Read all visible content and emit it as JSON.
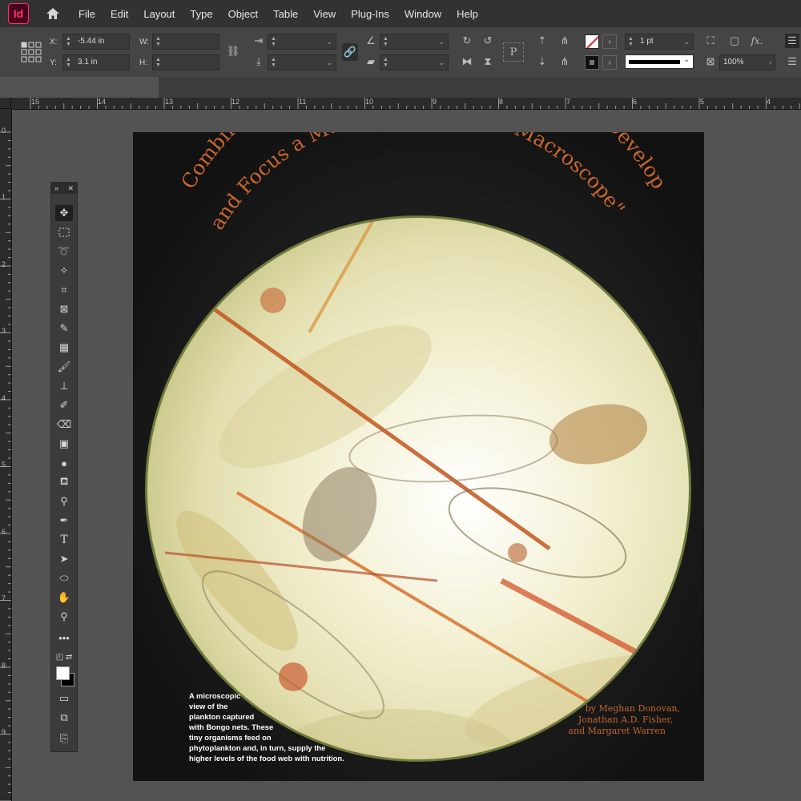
{
  "app": {
    "logo_text": "Id"
  },
  "menu": [
    "File",
    "Edit",
    "Layout",
    "Type",
    "Object",
    "Table",
    "View",
    "Plug-Ins",
    "Window",
    "Help"
  ],
  "control": {
    "x_label": "X:",
    "x_value": "-5.44 in",
    "y_label": "Y:",
    "y_value": "3.1 in",
    "w_label": "W:",
    "h_label": "H:",
    "stroke_weight": "1 pt",
    "opacity": "100%",
    "fx_label": "fx."
  },
  "ruler": {
    "horizontal": [
      "15",
      "14",
      "13",
      "12",
      "11",
      "10",
      "9",
      "8",
      "7",
      "6",
      "5",
      "4"
    ],
    "vertical": [
      "0",
      "1",
      "2",
      "3",
      "4",
      "5",
      "6",
      "7",
      "8",
      "9"
    ]
  },
  "document": {
    "title_line1": "Combining Minimally Invasive Technologies to Develop",
    "title_line2": "and Focus a Marine Monitoring \"Macroscope\"",
    "caption": "A microscopic view of the plankton captured with Bongo nets. These tiny organisms feed on phytoplankton and, in turn, supply the higher levels of the food web with nutrition.",
    "caption_lines": [
      "A microscopic",
      "view of the",
      "plankton captured",
      "with Bongo nets. These",
      "tiny organisms feed on",
      "phytoplankton and, in turn, supply the",
      "higher levels of the food web with nutrition."
    ],
    "byline": [
      "by Meghan Donovan,",
      "Jonathan A.D. Fisher,",
      "and Margaret Warren"
    ],
    "title_color": "#c8662c"
  },
  "tools": [
    "selection-tool-icon",
    "rectangle-frame-tool-icon",
    "lasso-tool-icon",
    "magic-wand-tool-icon",
    "crop-tool-icon",
    "frame-grid-tool-icon",
    "eyedropper-tool-icon",
    "color-theme-tool-icon",
    "brush-tool-icon",
    "stamp-tool-icon",
    "healing-brush-tool-icon",
    "eraser-tool-icon",
    "gradient-tool-icon",
    "blur-tool-icon",
    "paint-bucket-tool-icon",
    "dodge-tool-icon",
    "pen-tool-icon",
    "type-tool-icon",
    "direct-selection-tool-icon",
    "ellipse-tool-icon",
    "hand-tool-icon",
    "zoom-tool-icon",
    "more-tools-icon"
  ]
}
